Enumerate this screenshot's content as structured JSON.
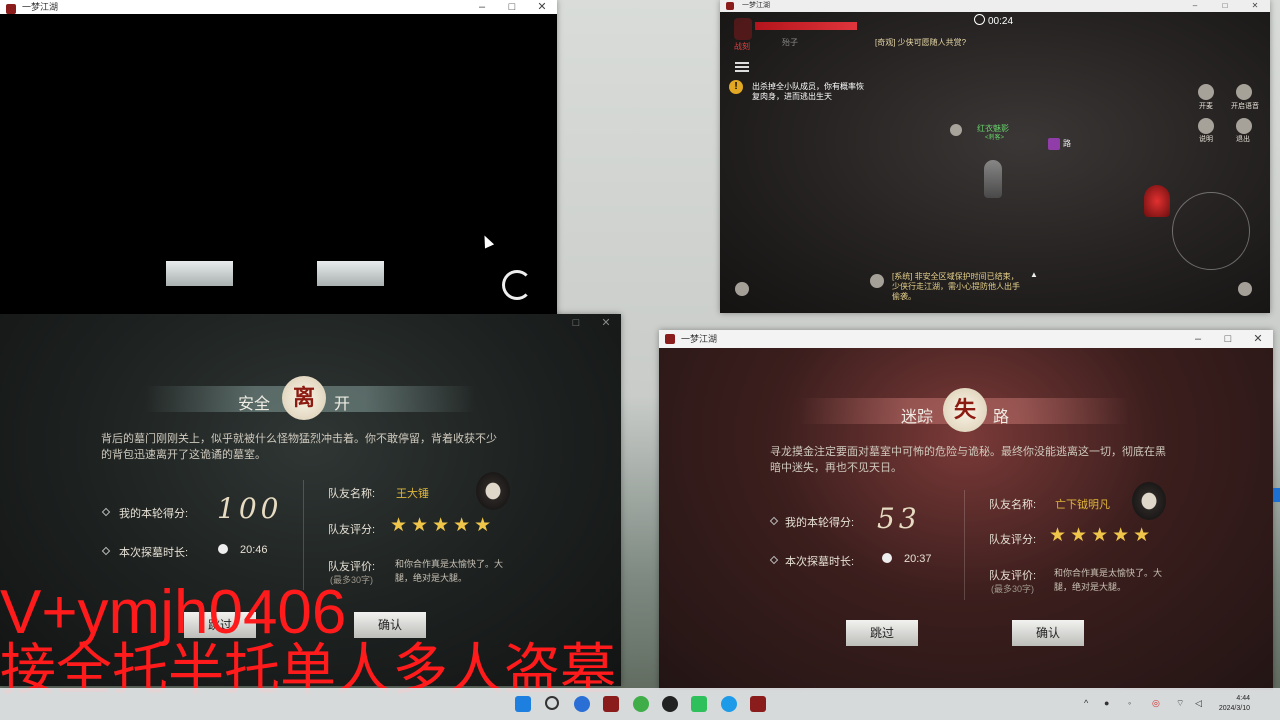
{
  "window_title": "一梦江湖",
  "win_controls": {
    "min": "–",
    "max": "□",
    "close": "✕"
  },
  "game": {
    "timer": "00:24",
    "player_label": "战刻",
    "small_label": "殆子",
    "chat_top": "[奇观] 少侠可愿随人共赏?",
    "quest_text": "出杀掉全小队成员，你有概率恢复肉身，进而逃出生天",
    "npc_name": "红衣魅影",
    "npc_sub": "<刺客>",
    "tag_label": "路",
    "hud": {
      "b1": "开麦",
      "b2": "开启语音",
      "b3": "说明",
      "b4": "退出"
    },
    "system_msg": "[系统] 非安全区域保护时间已结束，少侠行走江湖，需小心提防他人出手偷袭。"
  },
  "panel_left": {
    "banner_left": "安全",
    "banner_seal": "离",
    "banner_right": "开",
    "desc": "背后的墓门刚刚关上，似乎就被什么怪物猛烈冲击着。你不敢停留，背着收获不少的背包迅速离开了这诡谲的墓室。",
    "score_label": "我的本轮得分:",
    "score": "100",
    "time_label": "本次探墓时长:",
    "time": "20:46",
    "mate_name_label": "队友名称:",
    "mate_name": "王大锤",
    "mate_rating_label": "队友评分:",
    "stars": "★★★★★",
    "mate_comment_label": "队友评价:",
    "mate_comment_sub": "(最多30字)",
    "mate_comment": "和你合作真是太愉快了。大腿，绝对是大腿。",
    "skip": "跳过",
    "confirm": "确认"
  },
  "panel_right": {
    "banner_left": "迷踪",
    "banner_seal": "失",
    "banner_right": "路",
    "desc": "寻龙摸金注定要面对墓室中可怖的危险与诡秘。最终你没能逃离这一切，彻底在黑暗中迷失，再也不见天日。",
    "score_label": "我的本轮得分:",
    "score": "53",
    "time_label": "本次探墓时长:",
    "time": "20:37",
    "mate_name_label": "队友名称:",
    "mate_name": "亡下钺明凡",
    "mate_rating_label": "队友评分:",
    "stars": "★★★★★",
    "mate_comment_label": "队友评价:",
    "mate_comment_sub": "(最多30字)",
    "mate_comment": "和你合作真是太愉快了。大腿，绝对是大腿。",
    "skip": "跳过",
    "confirm": "确认"
  },
  "watermark": {
    "line1": "V+ymjh0406",
    "line2": "接全托半托单人多人盗墓"
  },
  "taskbar": {
    "time": "4:44",
    "date": "2024/3/10"
  },
  "colors": {
    "accent_red": "#ff1b1b",
    "gold": "#e0b63a",
    "star": "#f0c64a"
  }
}
